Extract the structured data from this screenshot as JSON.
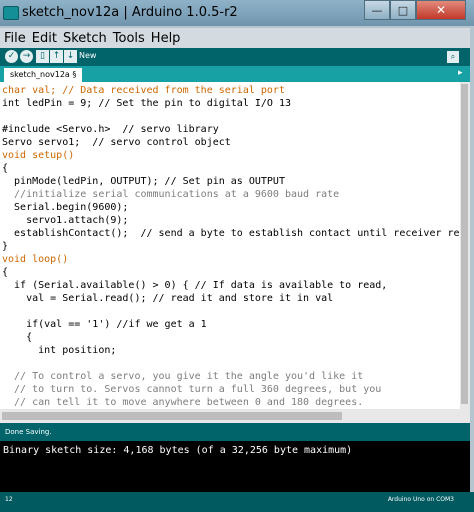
{
  "window": {
    "title": "sketch_nov12a | Arduino 1.0.5-r2",
    "min": "—",
    "max": "□",
    "close": "✕"
  },
  "menu": [
    "File",
    "Edit",
    "Sketch",
    "Tools",
    "Help"
  ],
  "toolbar": {
    "hover_label": "New",
    "icons": [
      "verify-icon",
      "upload-icon",
      "new-icon",
      "open-icon",
      "save-icon",
      "serial-monitor-icon"
    ]
  },
  "tab": {
    "name": "sketch_nov12a §"
  },
  "code_lines": [
    "char val; // Data received from the serial port",
    "int ledPin = 9; // Set the pin to digital I/O 13",
    "",
    "#include <Servo.h>  // servo library",
    "Servo servo1;  // servo control object",
    "void setup()",
    "{",
    "  pinMode(ledPin, OUTPUT); // Set pin as OUTPUT",
    "  //initialize serial communications at a 9600 baud rate",
    "  Serial.begin(9600);",
    "    servo1.attach(9);",
    "  establishContact();  // send a byte to establish contact until receiver respon",
    "}",
    "void loop()",
    "{",
    "  if (Serial.available() > 0) { // If data is available to read,",
    "    val = Serial.read(); // read it and store it in val",
    "",
    "    if(val == '1') //if we get a 1",
    "    {",
    "      int position;",
    "",
    "  // To control a servo, you give it the angle you'd like it",
    "  // to turn to. Servos cannot turn a full 360 degrees, but you",
    "  // can tell it to move anywhere between 0 and 180 degrees."
  ],
  "status": {
    "message": "Done Saving."
  },
  "console": {
    "output": "Binary sketch size: 4,168 bytes (of a 32,256 byte maximum)"
  },
  "footer": {
    "line": "12",
    "board": "Arduino Uno on COM3"
  },
  "colors": {
    "toolbar": "#00646a",
    "tabbar": "#17a1a5",
    "keyword": "#cc6600",
    "comment": "#7e7e7e"
  }
}
